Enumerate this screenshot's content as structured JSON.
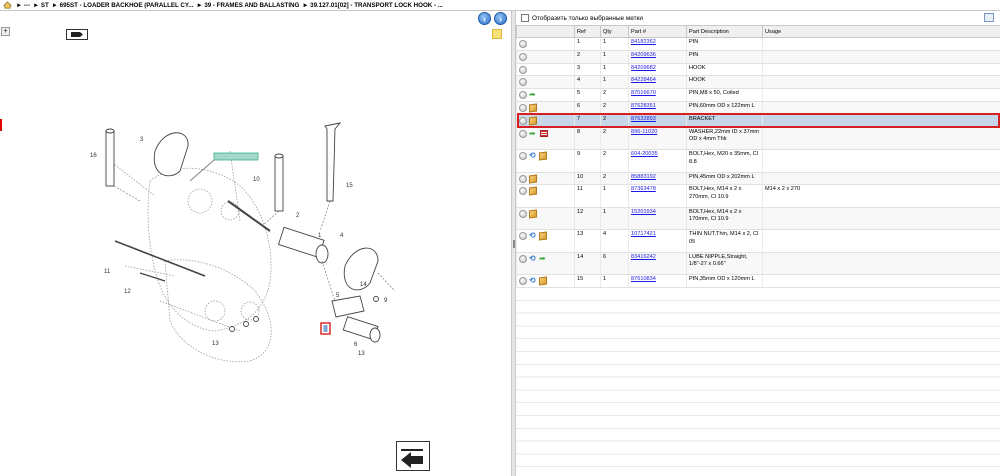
{
  "breadcrumb": [
    "►  ---",
    "►  ST",
    "►  695ST - LOADER BACKHOE (PARALLEL CY...",
    "►  39 - FRAMES AND BALLASTING",
    "►  39.127.01[02] - TRANSPORT LOCK HOOK - ..."
  ],
  "filter": {
    "label": "Отобразить только выбранные метки"
  },
  "table": {
    "headers": [
      "Ref",
      "Qty",
      "Part #",
      "Part Description",
      "Usage"
    ],
    "rows": [
      {
        "icons": [
          "circle"
        ],
        "ref": "1",
        "qty": "1",
        "part": "84182362",
        "desc": "PIN",
        "usage": ""
      },
      {
        "icons": [
          "circle"
        ],
        "ref": "2",
        "qty": "1",
        "part": "84209636",
        "desc": "PIN",
        "usage": ""
      },
      {
        "icons": [
          "circle"
        ],
        "ref": "3",
        "qty": "1",
        "part": "84209682",
        "desc": "HOOK",
        "usage": ""
      },
      {
        "icons": [
          "circle"
        ],
        "ref": "4",
        "qty": "1",
        "part": "84228464",
        "desc": "HOOK",
        "usage": ""
      },
      {
        "icons": [
          "circle",
          "arrow-green"
        ],
        "ref": "5",
        "qty": "2",
        "part": "87016670",
        "desc": "PIN,M8 x 50, Coiled",
        "usage": ""
      },
      {
        "icons": [
          "circle",
          "box"
        ],
        "ref": "6",
        "qty": "2",
        "part": "87628351",
        "desc": "PIN,60mm OD x 122mm L",
        "usage": ""
      },
      {
        "icons": [
          "circle",
          "box"
        ],
        "ref": "7",
        "qty": "2",
        "part": "87632893",
        "desc": "BRACKET",
        "usage": "",
        "selected": true
      },
      {
        "icons": [
          "circle",
          "arrow-green",
          "flag"
        ],
        "ref": "8",
        "qty": "2",
        "part": "896-11020",
        "desc": "WASHER,22mm ID x 37mm OD x 4mm Thk",
        "usage": ""
      },
      {
        "icons": [
          "circle",
          "arrow-blue",
          "box"
        ],
        "ref": "9",
        "qty": "2",
        "part": "604-20035",
        "desc": "BOLT,Hex, M20 x 35mm, Cl 8.8",
        "usage": ""
      },
      {
        "icons": [
          "circle",
          "box"
        ],
        "ref": "10",
        "qty": "2",
        "part": "85883192",
        "desc": "PIN,45mm OD x 202mm L",
        "usage": ""
      },
      {
        "icons": [
          "circle",
          "box"
        ],
        "ref": "11",
        "qty": "1",
        "part": "87363478",
        "desc": "BOLT,Hex, M14 x 2 x 270mm, Cl 10.9",
        "usage": "M14 x 2 x 270"
      },
      {
        "icons": [
          "circle",
          "box"
        ],
        "ref": "12",
        "qty": "1",
        "part": "15201934",
        "desc": "BOLT,Hex, M14 x 2 x 170mm, Cl 10.9",
        "usage": ""
      },
      {
        "icons": [
          "circle",
          "arrow-blue",
          "box"
        ],
        "ref": "13",
        "qty": "4",
        "part": "10717421",
        "desc": "THIN NUT,Thin, M14 x 2, Cl 05",
        "usage": ""
      },
      {
        "icons": [
          "circle",
          "arrow-blue",
          "arrow-green"
        ],
        "ref": "14",
        "qty": "6",
        "part": "83416242",
        "desc": "LUBE NIPPLE,Straight, 1/8\"-27 x 0.66\"",
        "usage": ""
      },
      {
        "icons": [
          "circle",
          "arrow-blue",
          "box"
        ],
        "ref": "15",
        "qty": "1",
        "part": "87610834",
        "desc": "PIN,35mm OD x 120mm L",
        "usage": ""
      }
    ]
  },
  "drawing": {
    "callouts": [
      "1",
      "2",
      "3",
      "4",
      "5",
      "6",
      "7",
      "8",
      "9",
      "10",
      "11",
      "12",
      "13",
      "14",
      "15",
      "16"
    ],
    "highlight_label": "7"
  },
  "colors": {
    "selection": "#c6d7ea",
    "highlight": "#d61f1f",
    "link": "#1a1ae6"
  }
}
